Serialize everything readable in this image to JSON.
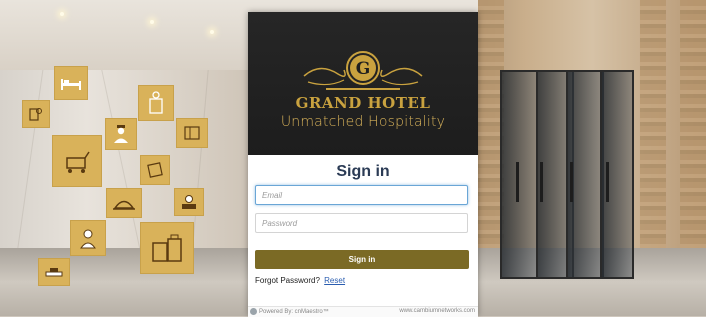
{
  "brand": {
    "emblem_letter": "G",
    "name": "GRAND HOTEL",
    "tagline": "Unmatched Hospitality"
  },
  "signin": {
    "title": "Sign in",
    "email_placeholder": "Email",
    "password_placeholder": "Password",
    "button_label": "Sign in",
    "forgot_text": "Forgot Password?",
    "reset_label": "Reset"
  },
  "footer": {
    "powered_by": "Powered By: cnMaestro™",
    "website": "www.cambiumnetworks.com"
  },
  "colors": {
    "header_bg": "#1f1f1f",
    "gold": "#c9a23f",
    "button": "#7b6a25",
    "title": "#2b3b55",
    "link": "#2a5db0",
    "tile": "#d9b25a"
  },
  "icons": [
    "hotel-bed-icon",
    "keycard-icon",
    "do-not-disturb-icon",
    "bellboy-icon",
    "room-service-cart-icon",
    "ticket-icon",
    "hotel-map-icon",
    "cloche-icon",
    "receptionist-icon",
    "maid-icon",
    "luggage-icon",
    "doorbell-icon"
  ]
}
